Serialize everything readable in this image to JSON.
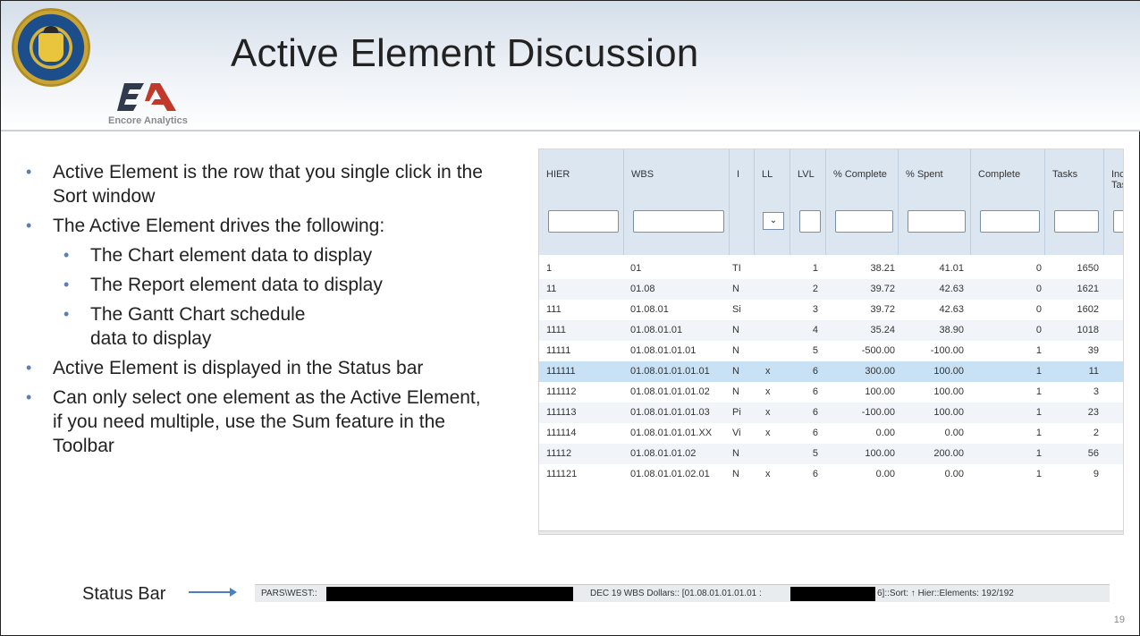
{
  "slide": {
    "title": "Active Element Discussion",
    "logo_text": "Encore Analytics",
    "page_number": "19"
  },
  "bullets": [
    {
      "level": 1,
      "text": "Active Element is the row that you single click in the Sort window"
    },
    {
      "level": 1,
      "text": "The Active Element drives the following:"
    },
    {
      "level": 2,
      "text": "The Chart element data to display"
    },
    {
      "level": 2,
      "text": "The Report element data to display"
    },
    {
      "level": 2,
      "text": "The Gantt Chart schedule data to display"
    },
    {
      "level": 1,
      "text": "Active Element is displayed in the Status bar"
    },
    {
      "level": 1,
      "text": "Can only select one element as the Active Element, if you need multiple, use the Sum feature in the Toolbar"
    }
  ],
  "grid": {
    "columns": [
      "HIER",
      "WBS",
      "I",
      "LL",
      "LVL",
      "% Complete",
      "% Spent",
      "Complete",
      "Tasks",
      "Inc Tas"
    ],
    "ll_filter_glyph": "⌄",
    "rows": [
      [
        "1",
        "01",
        "TI",
        "",
        "1",
        "38.21",
        "41.01",
        "0",
        "1650"
      ],
      [
        "11",
        "01.08",
        "N",
        "",
        "2",
        "39.72",
        "42.63",
        "0",
        "1621"
      ],
      [
        "111",
        "01.08.01",
        "Si",
        "",
        "3",
        "39.72",
        "42.63",
        "0",
        "1602"
      ],
      [
        "1111",
        "01.08.01.01",
        "N",
        "",
        "4",
        "35.24",
        "38.90",
        "0",
        "1018"
      ],
      [
        "11111",
        "01.08.01.01.01",
        "N",
        "",
        "5",
        "-500.00",
        "-100.00",
        "1",
        "39"
      ],
      [
        "111111",
        "01.08.01.01.01.01",
        "N",
        "x",
        "6",
        "300.00",
        "100.00",
        "1",
        "11"
      ],
      [
        "111112",
        "01.08.01.01.01.02",
        "N",
        "x",
        "6",
        "100.00",
        "100.00",
        "1",
        "3"
      ],
      [
        "111113",
        "01.08.01.01.01.03",
        "Pi",
        "x",
        "6",
        "-100.00",
        "100.00",
        "1",
        "23"
      ],
      [
        "111114",
        "01.08.01.01.01.XX",
        "Vi",
        "x",
        "6",
        "0.00",
        "0.00",
        "1",
        "2"
      ],
      [
        "11112",
        "01.08.01.01.02",
        "N",
        "",
        "5",
        "100.00",
        "200.00",
        "1",
        "56"
      ],
      [
        "111121",
        "01.08.01.01.02.01",
        "N",
        "x",
        "6",
        "0.00",
        "0.00",
        "1",
        "9"
      ]
    ],
    "selected_row": 5
  },
  "status": {
    "label": "Status Bar",
    "prefix": "PARS\\WEST::",
    "middle": "DEC 19 WBS Dollars:: [01.08.01.01.01.01 :",
    "suffix": "6]::Sort: ↑ Hier::Elements: 192/192"
  }
}
